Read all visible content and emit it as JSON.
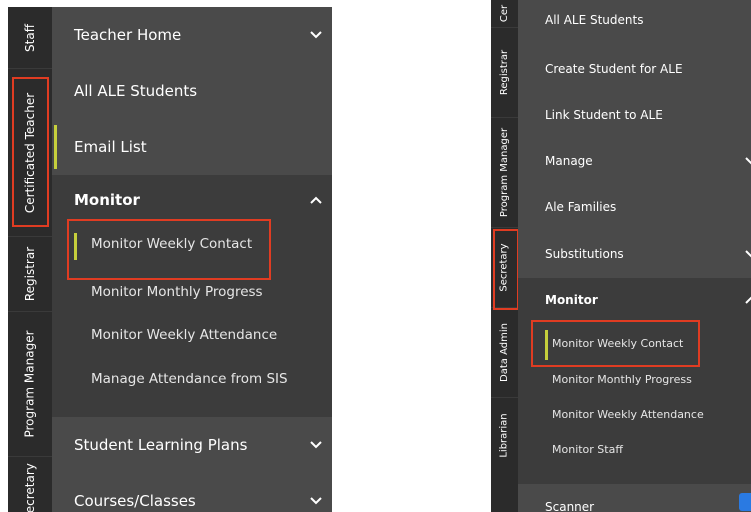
{
  "left_panel": {
    "rail_tabs": [
      "Staff",
      "Certificated Teacher",
      "Registrar",
      "Program Manager",
      "Secretary"
    ],
    "menu": {
      "teacher_home": "Teacher Home",
      "all_ale_students": "All ALE Students",
      "email_list": "Email List",
      "monitor": "Monitor",
      "monitor_items": [
        "Monitor Weekly Contact",
        "Monitor Monthly Progress",
        "Monitor Weekly Attendance",
        "Manage Attendance from SIS"
      ],
      "student_learning_plans": "Student Learning Plans",
      "courses_classes": "Courses/Classes"
    }
  },
  "right_panel": {
    "rail_tabs": [
      "Cer",
      "Registrar",
      "Program Manager",
      "Secretary",
      "Data Admin",
      "Librarian"
    ],
    "menu": {
      "items": [
        "All ALE Students",
        "Create Student for ALE",
        "Link Student to ALE",
        "Manage",
        "Ale Families",
        "Substitutions"
      ],
      "monitor": "Monitor",
      "monitor_items": [
        "Monitor Weekly Contact",
        "Monitor Monthly Progress",
        "Monitor Weekly Attendance",
        "Monitor Staff"
      ],
      "scanner": "Scanner"
    }
  },
  "colors": {
    "rail": "#2b2b2b",
    "menu": "#4a4a4a",
    "submenu": "#3c3c3c",
    "active_indicator": "#c6cf3c",
    "highlight_box": "#e03c22"
  }
}
